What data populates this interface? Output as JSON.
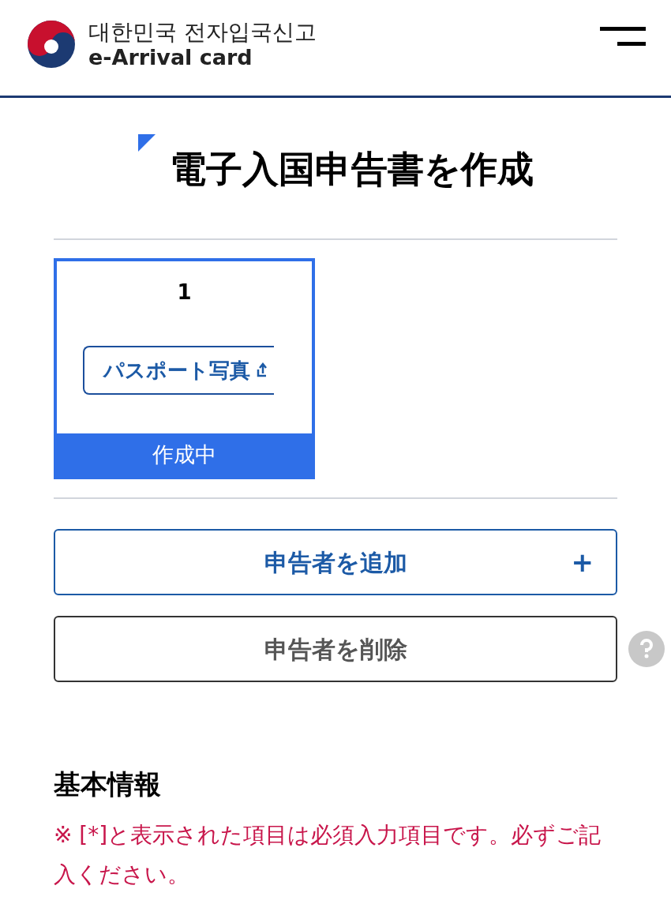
{
  "header": {
    "title_ko": "대한민국 전자입국신고",
    "title_en": "e-Arrival card"
  },
  "page_title": "電子入国申告書を作成",
  "applicants": [
    {
      "number": "1",
      "upload_label": "パスポート写真",
      "status": "作成中",
      "selected": true
    }
  ],
  "actions": [
    {
      "kind": "primary",
      "label": "申告者を追加",
      "icon": "+"
    },
    {
      "kind": "secondary",
      "label": "申告者を削除"
    }
  ],
  "section": {
    "title": "基本情報",
    "notice": "※ [*]と表示された項目は必須入力項目です。必ずご記入ください。"
  }
}
